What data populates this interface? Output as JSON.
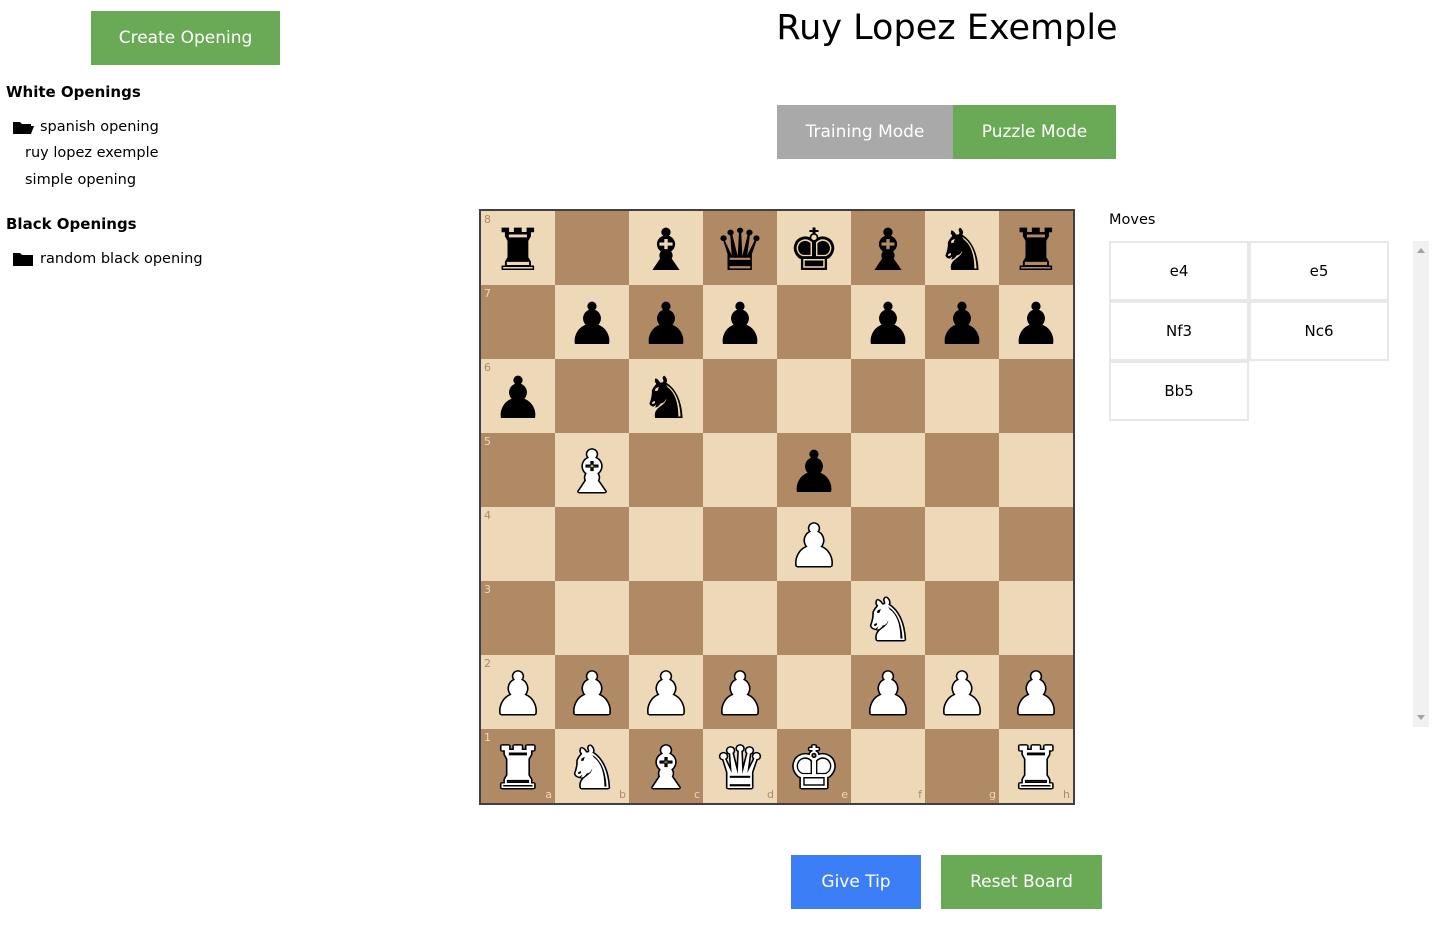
{
  "sidebar": {
    "create_label": "Create Opening",
    "white_title": "White Openings",
    "white_folder": "spanish opening",
    "white_items": [
      "ruy lopez exemple",
      "simple opening"
    ],
    "black_title": "Black Openings",
    "black_folder": "random black opening"
  },
  "title": "Ruy Lopez Exemple",
  "modes": {
    "training": "Training Mode",
    "puzzle": "Puzzle Mode",
    "active": "puzzle"
  },
  "board": {
    "files": [
      "a",
      "b",
      "c",
      "d",
      "e",
      "f",
      "g",
      "h"
    ],
    "ranks": [
      "8",
      "7",
      "6",
      "5",
      "4",
      "3",
      "2",
      "1"
    ],
    "position": [
      [
        "r",
        "",
        "b",
        "q",
        "k",
        "b",
        "n",
        "r"
      ],
      [
        "",
        "p",
        "p",
        "p",
        "",
        "p",
        "p",
        "p"
      ],
      [
        "p",
        "",
        "n",
        "",
        "",
        "",
        "",
        ""
      ],
      [
        "",
        "B",
        "",
        "",
        "p",
        "",
        "",
        ""
      ],
      [
        "",
        "",
        "",
        "",
        "P",
        "",
        "",
        ""
      ],
      [
        "",
        "",
        "",
        "",
        "",
        "N",
        "",
        ""
      ],
      [
        "P",
        "P",
        "P",
        "P",
        "",
        "P",
        "P",
        "P"
      ],
      [
        "R",
        "N",
        "B",
        "Q",
        "K",
        "",
        "",
        "R"
      ]
    ],
    "light_color": "#edd9b7",
    "dark_color": "#b08965"
  },
  "moves_label": "Moves",
  "moves": [
    "e4",
    "e5",
    "Nf3",
    "Nc6",
    "Bb5"
  ],
  "actions": {
    "tip": "Give Tip",
    "reset": "Reset Board"
  },
  "colors": {
    "green": "#6aaa57",
    "gray": "#a9a9a9",
    "blue": "#3c7ef6"
  }
}
